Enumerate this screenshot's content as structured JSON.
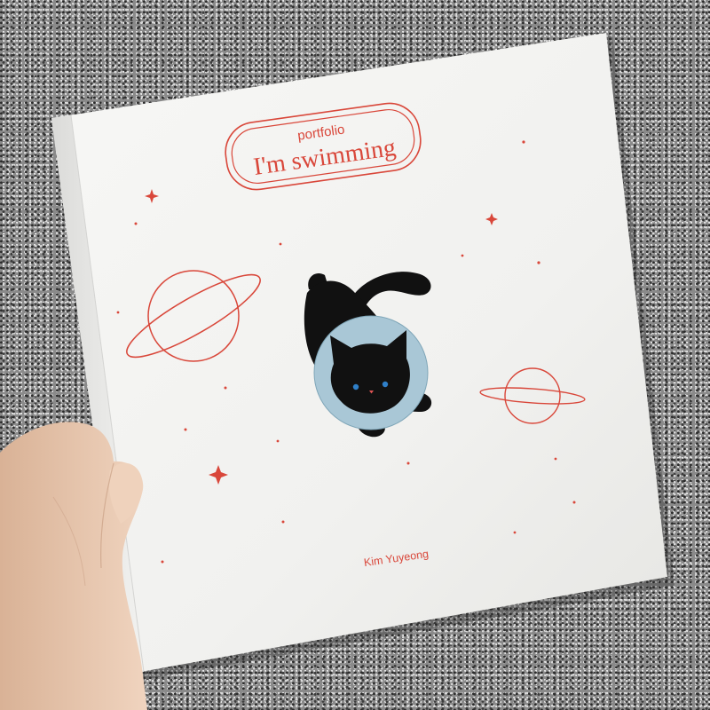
{
  "book": {
    "subtitle": "portfolio",
    "title": "I'm swimming",
    "author": "Kim Yuyeong"
  },
  "colors": {
    "cover": "#f4f4f2",
    "accent": "#d9473a",
    "cat": "#111111",
    "helmet": "#a9c7d6",
    "eyes": "#2f7fc8",
    "nose": "#e05555",
    "skin": "#e8c9b1",
    "floor": "#8a8a8a"
  },
  "icons": {
    "planet_large": "ringed-planet-icon",
    "planet_small": "ringed-planet-icon",
    "stars": "sparkle-star-icon",
    "cat": "astronaut-cat-illustration"
  }
}
